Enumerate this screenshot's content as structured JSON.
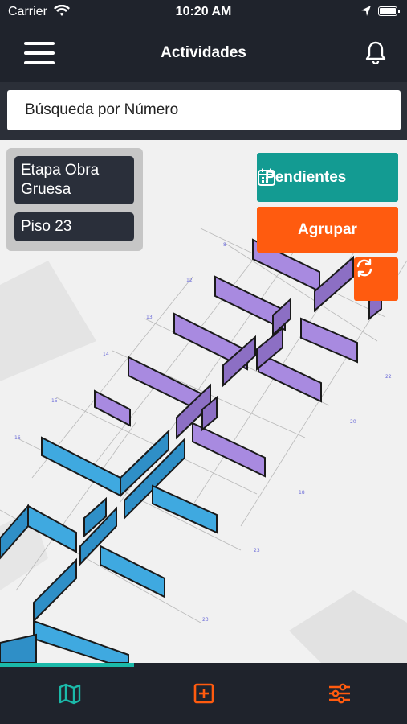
{
  "status_bar": {
    "carrier": "Carrier",
    "time": "10:20 AM"
  },
  "header": {
    "title": "Actividades"
  },
  "search": {
    "placeholder": "Búsqueda por Número"
  },
  "filters": {
    "stage": "Etapa Obra Gruesa",
    "floor": "Piso 23"
  },
  "actions": {
    "pending_label": "Pendientes",
    "group_label": "Agrupar"
  },
  "progress": {
    "fraction": 0.33
  },
  "tabs": [
    {
      "icon": "map-icon",
      "color": "#1bb9a9"
    },
    {
      "icon": "add-square-icon",
      "color": "#ff5b0f"
    },
    {
      "icon": "sliders-icon",
      "color": "#ff5b0f"
    }
  ],
  "colors": {
    "teal": "#139b92",
    "orange": "#ff5b0f",
    "dark": "#1f232c",
    "purple_wall": "#9b7fd4",
    "blue_wall": "#3aa3dc"
  }
}
